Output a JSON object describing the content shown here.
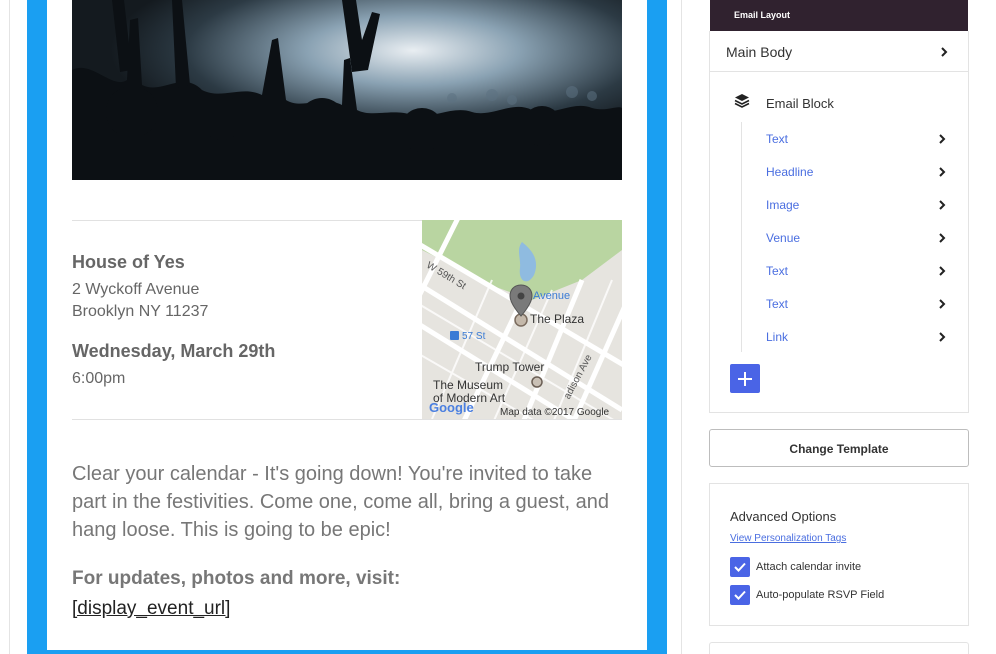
{
  "email": {
    "venue_name": "House of Yes",
    "address_line1": "2 Wyckoff Avenue",
    "address_line2": "Brooklyn NY 11237",
    "date": "Wednesday, March 29th",
    "time": "6:00pm",
    "body_text": "Clear your calendar - It's going down! You're invited to take part in the festivities. Come one, come all, bring a guest, and hang loose. This is going to be epic!",
    "updates_label": "For updates, photos and more, visit:",
    "event_url": "[display_event_url]",
    "map": {
      "street_w59": "W 59th St",
      "avenue": "Avenue",
      "plaza": "The Plaza",
      "subway_57": "57 St",
      "trump_tower": "Trump Tower",
      "museum_line1": "The Museum",
      "museum_line2": "of Modern Art",
      "madison": "adison Ave",
      "google": "Google",
      "map_data": "Map data ©2017 Google"
    }
  },
  "sidebar": {
    "header_title": "Email Layout",
    "main_body_label": "Main Body",
    "block_label": "Email Block",
    "items": [
      {
        "label": "Text"
      },
      {
        "label": "Headline"
      },
      {
        "label": "Image"
      },
      {
        "label": "Venue"
      },
      {
        "label": "Text"
      },
      {
        "label": "Text"
      },
      {
        "label": "Link"
      }
    ],
    "add_icon": "plus-icon",
    "change_template_label": "Change Template",
    "advanced": {
      "title": "Advanced Options",
      "link_label": "View Personalization Tags",
      "options": [
        {
          "label": "Attach calendar invite",
          "checked": true
        },
        {
          "label": "Auto-populate RSVP Field",
          "checked": true
        }
      ]
    }
  },
  "colors": {
    "frame_blue": "#1a9ff2",
    "accent": "#4a64e6",
    "link": "#4a6ee0",
    "header_dark": "#30222f"
  }
}
